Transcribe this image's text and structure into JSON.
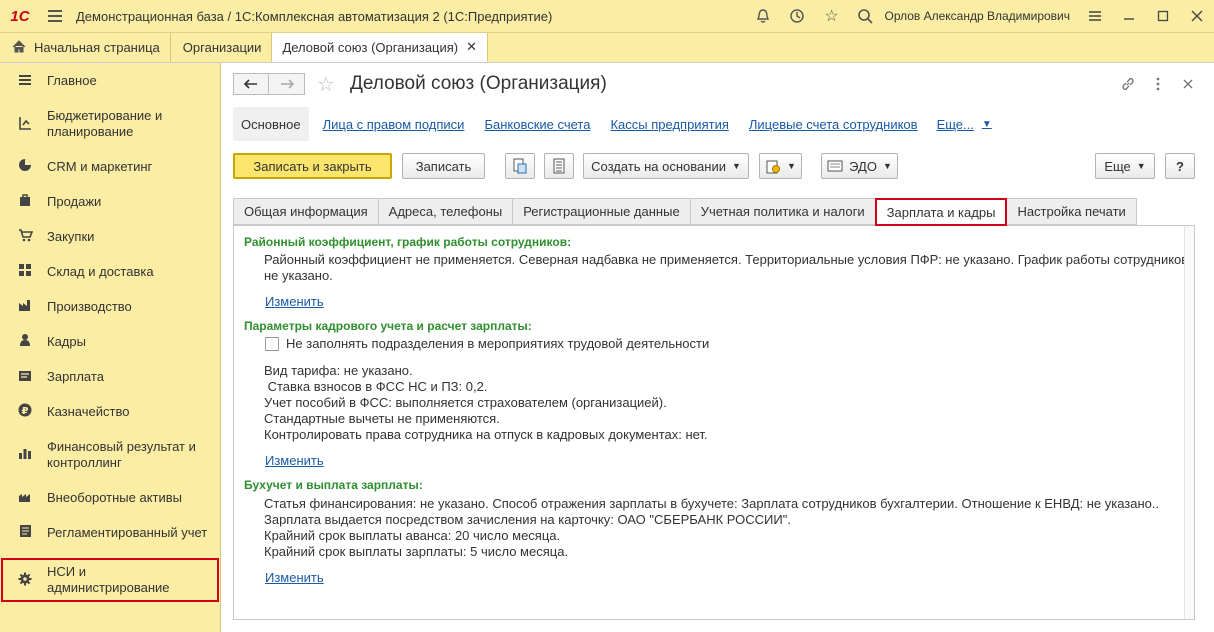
{
  "app": {
    "logo": "1С",
    "title": "Демонстрационная база / 1С:Комплексная автоматизация 2  (1С:Предприятие)",
    "user": "Орлов Александр Владимирович"
  },
  "open_tabs": [
    {
      "label": "Начальная страница"
    },
    {
      "label": "Организации"
    },
    {
      "label": "Деловой союз (Организация)"
    }
  ],
  "sidebar": {
    "items": [
      {
        "label": "Главное",
        "icon": "menu-icon"
      },
      {
        "label": "Бюджетирование и планирование",
        "icon": "budget-icon"
      },
      {
        "label": "CRM и маркетинг",
        "icon": "pie-icon"
      },
      {
        "label": "Продажи",
        "icon": "bag-icon"
      },
      {
        "label": "Закупки",
        "icon": "cart-icon"
      },
      {
        "label": "Склад и доставка",
        "icon": "warehouse-icon"
      },
      {
        "label": "Производство",
        "icon": "factory-icon"
      },
      {
        "label": "Кадры",
        "icon": "person-icon"
      },
      {
        "label": "Зарплата",
        "icon": "salary-icon"
      },
      {
        "label": "Казначейство",
        "icon": "ruble-icon"
      },
      {
        "label": "Финансовый результат и контроллинг",
        "icon": "chart-icon"
      },
      {
        "label": "Внеоборотные активы",
        "icon": "assets-icon"
      },
      {
        "label": "Регламентированный учет",
        "icon": "ledger-icon"
      },
      {
        "label": "НСИ и администрирование",
        "icon": "gear-icon"
      }
    ]
  },
  "form": {
    "title": "Деловой союз (Организация)",
    "links": {
      "main": "Основное",
      "items": [
        "Лица с правом подписи",
        "Банковские счета",
        "Кассы предприятия",
        "Лицевые счета сотрудников"
      ],
      "more": "Еще..."
    },
    "toolbar": {
      "save_close": "Записать и закрыть",
      "save": "Записать",
      "create_based": "Создать на основании",
      "edo": "ЭДО",
      "more": "Еще",
      "help": "?"
    },
    "tabs": [
      "Общая информация",
      "Адреса, телефоны",
      "Регистрационные данные",
      "Учетная политика и налоги",
      "Зарплата и кадры",
      "Настройка печати"
    ],
    "sections": {
      "s1_title": "Районный коэффициент, график работы сотрудников:",
      "s1_text1": "Районный коэффициент не применяется. Северная надбавка не применяется. Территориальные условия ПФР: не указано. График работы сотрудников:",
      "s1_text2": "не указано.",
      "change": "Изменить",
      "s2_title": "Параметры кадрового учета и расчет зарплаты:",
      "s2_checkbox": "Не заполнять подразделения в мероприятиях трудовой деятельности",
      "s2_lines": [
        "Вид тарифа: не указано.",
        " Ставка взносов в ФСС НС и ПЗ: 0,2.",
        "Учет пособий в ФСС: выполняется страхователем (организацией).",
        "Стандартные вычеты не применяются.",
        "Контролировать права сотрудника на отпуск в кадровых документах: нет."
      ],
      "s3_title": "Бухучет и выплата зарплаты:",
      "s3_lines": [
        "Статья финансирования: не указано. Способ отражения зарплаты в бухучете: Зарплата сотрудников бухгалтерии. Отношение к ЕНВД: не указано..",
        "Зарплата выдается посредством зачисления на карточку: ОАО \"СБЕРБАНК РОССИИ\".",
        "Крайний срок выплаты аванса: 20 число месяца.",
        "Крайний срок выплаты зарплаты: 5 число месяца."
      ]
    }
  },
  "colors": {
    "accent_yellow": "#fbeda4",
    "highlight_red": "#d0021b",
    "section_green": "#2f8f2f",
    "link_blue": "#1a5aa6"
  }
}
